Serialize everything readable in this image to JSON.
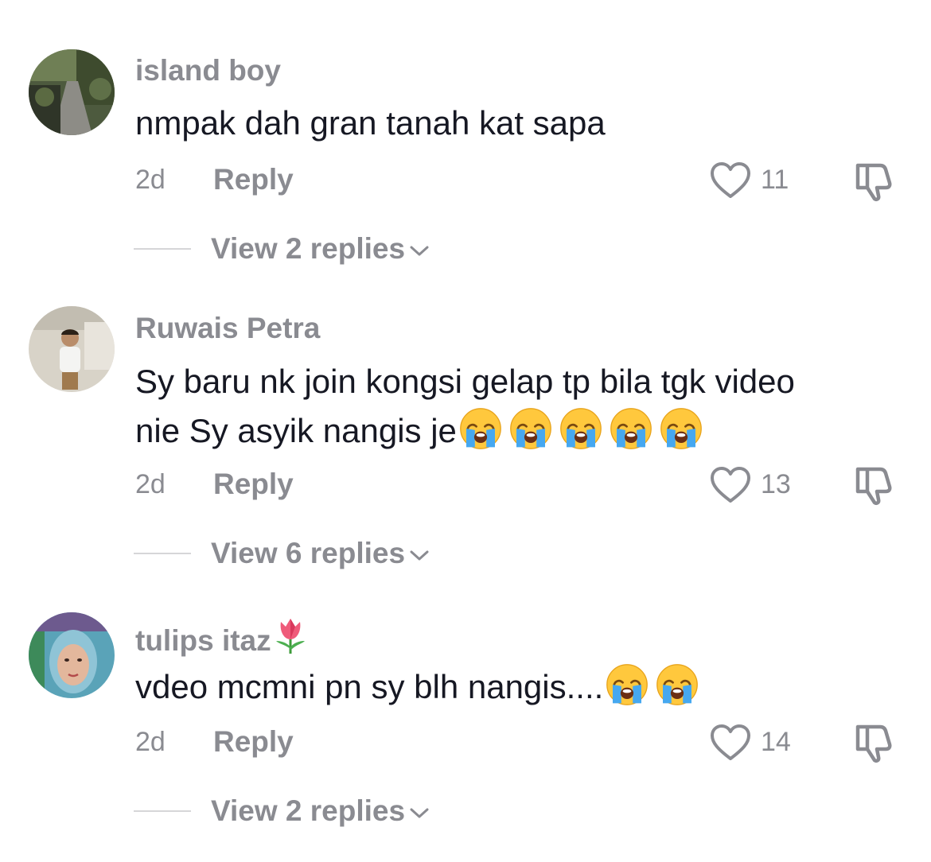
{
  "comments": [
    {
      "username": "island boy",
      "text": "nmpak dah gran tanah kat sapa",
      "emoji_count": 0,
      "time": "2d",
      "reply_label": "Reply",
      "likes": "11",
      "view_replies": "View 2 replies",
      "avatar_icon": "garden-path-photo"
    },
    {
      "username": "Ruwais Petra",
      "text_line1": "Sy baru nk join kongsi gelap tp bila tgk video",
      "text_line2": "nie Sy asyik nangis je",
      "emoji_count": 5,
      "emoji_icon": "loudly-crying-face-emoji",
      "time": "2d",
      "reply_label": "Reply",
      "likes": "13",
      "view_replies": "View 6 replies",
      "avatar_icon": "child-photo"
    },
    {
      "username": "tulips itaz",
      "username_emoji": "tulip-emoji",
      "text": "vdeo mcmni pn sy blh nangis....",
      "emoji_count": 2,
      "emoji_icon": "loudly-crying-face-emoji",
      "time": "2d",
      "reply_label": "Reply",
      "likes": "14",
      "view_replies": "View 2 replies",
      "avatar_icon": "woman-hijab-photo"
    }
  ],
  "colors": {
    "text": "#161823",
    "muted": "#8a8b91",
    "divider": "#d6d6d8"
  }
}
